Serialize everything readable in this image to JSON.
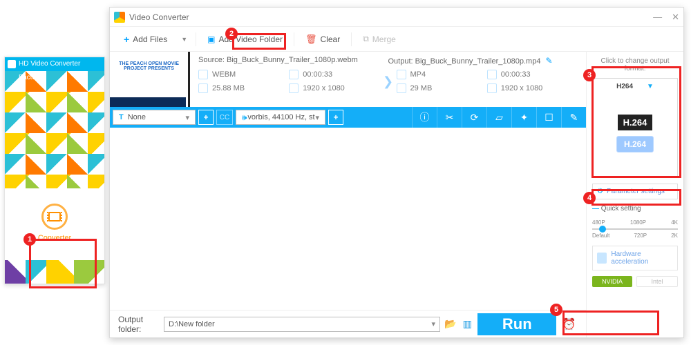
{
  "factory": {
    "title": "HD Video Converter Factory",
    "tile": "Converter"
  },
  "window": {
    "title": "Video Converter"
  },
  "toolbar": {
    "add_files": "Add Files",
    "add_folder": "Add Video Folder",
    "clear": "Clear",
    "merge": "Merge"
  },
  "item": {
    "thumb_caption": "THE PEACH OPEN MOVIE PROJECT PRESENTS",
    "source_label": "Source:",
    "source_name": "Big_Buck_Bunny_Trailer_1080p.webm",
    "output_label": "Output:",
    "output_name": "Big_Buck_Bunny_Trailer_1080p.mp4",
    "src": {
      "format": "WEBM",
      "duration": "00:00:33",
      "size": "25.88 MB",
      "res": "1920 x 1080"
    },
    "out": {
      "format": "MP4",
      "duration": "00:00:33",
      "size": "29 MB",
      "res": "1920 x 1080"
    }
  },
  "editbar": {
    "sub_prefix": "T",
    "sub_value": "None",
    "audio_value": "vorbis, 44100 Hz, st"
  },
  "side": {
    "hint": "Click to change output format:",
    "format": "H264",
    "codec_dark": "H.264",
    "codec_blue": "H.264",
    "param": "Parameter settings",
    "quick": "Quick setting",
    "ticks_top": [
      "480P",
      "1080P",
      "4K"
    ],
    "ticks_bot": [
      "Default",
      "720P",
      "2K"
    ],
    "accel": "Hardware acceleration",
    "nvidia": "NVIDIA",
    "intel": "Intel"
  },
  "footer": {
    "label": "Output folder:",
    "path": "D:\\New folder",
    "run": "Run"
  }
}
